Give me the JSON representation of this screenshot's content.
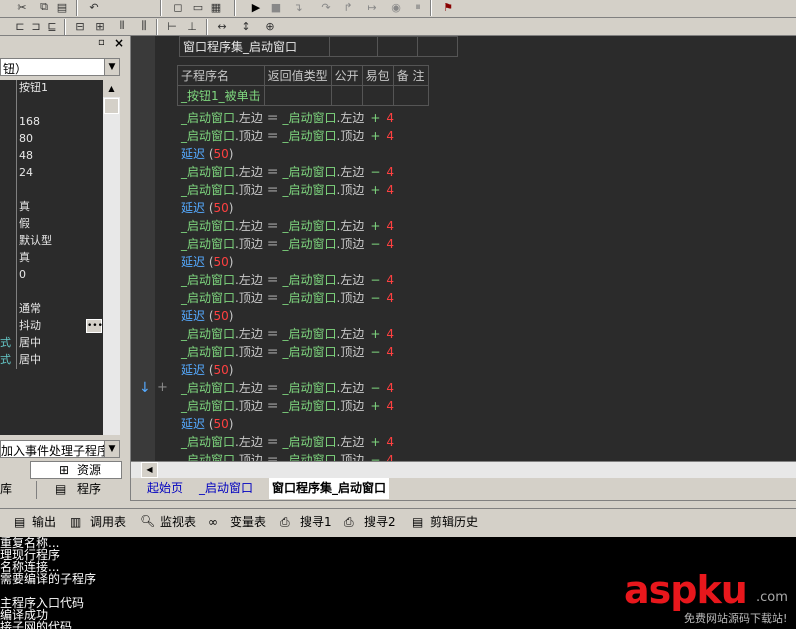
{
  "properties": {
    "dropdown_value": "钮）",
    "rows": [
      {
        "name": "",
        "value": "按钮1"
      },
      {
        "name": "",
        "value": ""
      },
      {
        "name": "",
        "value": "168"
      },
      {
        "name": "",
        "value": "80"
      },
      {
        "name": "",
        "value": "48"
      },
      {
        "name": "",
        "value": "24"
      },
      {
        "name": "",
        "value": ""
      },
      {
        "name": "",
        "value": "真"
      },
      {
        "name": "",
        "value": "假"
      },
      {
        "name": "",
        "value": "默认型"
      },
      {
        "name": "",
        "value": "真"
      },
      {
        "name": "",
        "value": "0"
      },
      {
        "name": "",
        "value": ""
      },
      {
        "name": "",
        "value": "通常"
      },
      {
        "name": "",
        "value": "抖动"
      },
      {
        "name": "式",
        "value": "居中"
      },
      {
        "name": "式",
        "value": "居中"
      }
    ],
    "event_dropdown": "加入事件处理子程序",
    "tab_resources": "资源",
    "tab_lib": "库",
    "tab_program": "程序"
  },
  "editor": {
    "assembly_title": "窗口程序集_启动窗口",
    "header_cols": [
      "子程序名",
      "返回值类型",
      "公开",
      "易包",
      "备 注"
    ],
    "sub_name": "_按钮1_被单击",
    "lines": [
      {
        "lhs_obj": "_启动窗口",
        "lhs_prop": "左边",
        "rhs_obj": "_启动窗口",
        "rhs_prop": "左边",
        "op": "+",
        "n": "4"
      },
      {
        "lhs_obj": "_启动窗口",
        "lhs_prop": "顶边",
        "rhs_obj": "_启动窗口",
        "rhs_prop": "顶边",
        "op": "+",
        "n": "4"
      },
      {
        "delay": "延迟",
        "arg": "50"
      },
      {
        "lhs_obj": "_启动窗口",
        "lhs_prop": "左边",
        "rhs_obj": "_启动窗口",
        "rhs_prop": "左边",
        "op": "−",
        "n": "4"
      },
      {
        "lhs_obj": "_启动窗口",
        "lhs_prop": "顶边",
        "rhs_obj": "_启动窗口",
        "rhs_prop": "顶边",
        "op": "+",
        "n": "4"
      },
      {
        "delay": "延迟",
        "arg": "50"
      },
      {
        "lhs_obj": "_启动窗口",
        "lhs_prop": "左边",
        "rhs_obj": "_启动窗口",
        "rhs_prop": "左边",
        "op": "+",
        "n": "4"
      },
      {
        "lhs_obj": "_启动窗口",
        "lhs_prop": "顶边",
        "rhs_obj": "_启动窗口",
        "rhs_prop": "顶边",
        "op": "−",
        "n": "4"
      },
      {
        "delay": "延迟",
        "arg": "50"
      },
      {
        "lhs_obj": "_启动窗口",
        "lhs_prop": "左边",
        "rhs_obj": "_启动窗口",
        "rhs_prop": "左边",
        "op": "−",
        "n": "4"
      },
      {
        "lhs_obj": "_启动窗口",
        "lhs_prop": "顶边",
        "rhs_obj": "_启动窗口",
        "rhs_prop": "顶边",
        "op": "−",
        "n": "4"
      },
      {
        "delay": "延迟",
        "arg": "50"
      },
      {
        "lhs_obj": "_启动窗口",
        "lhs_prop": "左边",
        "rhs_obj": "_启动窗口",
        "rhs_prop": "左边",
        "op": "+",
        "n": "4"
      },
      {
        "lhs_obj": "_启动窗口",
        "lhs_prop": "顶边",
        "rhs_obj": "_启动窗口",
        "rhs_prop": "顶边",
        "op": "−",
        "n": "4"
      },
      {
        "delay": "延迟",
        "arg": "50"
      },
      {
        "lhs_obj": "_启动窗口",
        "lhs_prop": "左边",
        "rhs_obj": "_启动窗口",
        "rhs_prop": "左边",
        "op": "−",
        "n": "4"
      },
      {
        "lhs_obj": "_启动窗口",
        "lhs_prop": "顶边",
        "rhs_obj": "_启动窗口",
        "rhs_prop": "顶边",
        "op": "+",
        "n": "4"
      },
      {
        "delay": "延迟",
        "arg": "50"
      },
      {
        "lhs_obj": "_启动窗口",
        "lhs_prop": "左边",
        "rhs_obj": "_启动窗口",
        "rhs_prop": "左边",
        "op": "+",
        "n": "4"
      },
      {
        "lhs_obj": "_启动窗口",
        "lhs_prop": "顶边",
        "rhs_obj": "_启动窗口",
        "rhs_prop": "顶边",
        "op": "−",
        "n": "4"
      }
    ]
  },
  "doc_tabs": [
    "起始页",
    "_启动窗口",
    "窗口程序集_启动窗口"
  ],
  "bottom_tabs": [
    "输出",
    "调用表",
    "监视表",
    "变量表",
    "搜寻1",
    "搜寻2",
    "剪辑历史"
  ],
  "output_lines": [
    "重复名称...",
    "理现行程序",
    "名称连接...",
    "需要编译的子程序",
    "",
    "主程序入口代码",
    "编译成功",
    "接子网的代码"
  ],
  "watermark": {
    "brand": "aspku",
    "tld": ".com",
    "slogan": "免费网站源码下载站!"
  }
}
